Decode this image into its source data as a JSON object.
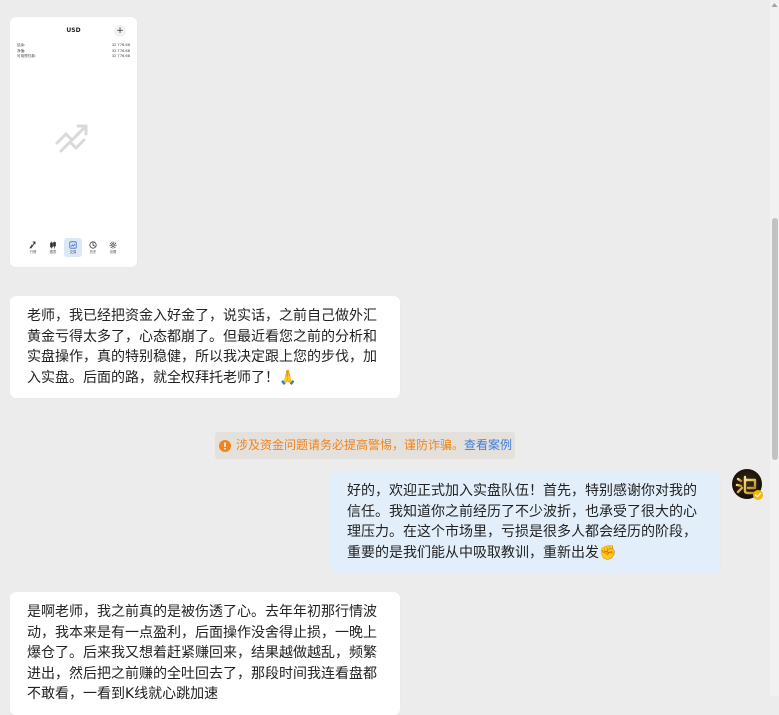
{
  "colors": {
    "background": "#ececec",
    "bubble_left": "#ffffff",
    "bubble_right": "#e2effa",
    "text": "#222222",
    "warning": "#f0841c",
    "link": "#3f7fd6"
  },
  "image_message": {
    "currency": "USD",
    "add_button": "+",
    "rows": [
      {
        "label": "结余:",
        "value": "32 776.68"
      },
      {
        "label": "净值:",
        "value": "32 776.68"
      },
      {
        "label": "可用预付款:",
        "value": "32 776.68"
      }
    ],
    "center_icon": "trend-up-icon",
    "nav": [
      {
        "label": "行情",
        "icon": "quotes-icon"
      },
      {
        "label": "图表",
        "icon": "chart-icon"
      },
      {
        "label": "交易",
        "icon": "trade-icon",
        "active": true
      },
      {
        "label": "历史",
        "icon": "history-icon"
      },
      {
        "label": "设置",
        "icon": "settings-icon"
      }
    ]
  },
  "messages": [
    {
      "side": "left",
      "lines": [
        "老师，我已经把资金入好金了，说实话，之前自己做外汇",
        "黄金亏得太多了，心态都崩了。但最近看您之前的分析和",
        "实盘操作，真的特别稳健，所以我决定跟上您的步伐，加",
        "入实盘。后面的路，就全权拜托老师了！🙏"
      ]
    },
    {
      "side": "right",
      "lines": [
        "好的，欢迎正式加入实盘队伍！首先，特别感谢你对我的",
        "信任。我知道你之前经历了不少波折，也承受了很大的心",
        "理压力。在这个市场里，亏损是很多人都会经历的阶段，",
        "重要的是我们能从中吸取教训，重新出发✊"
      ]
    },
    {
      "side": "left",
      "lines": [
        "是啊老师，我之前真的是被伤透了心。去年年初那行情波",
        "动，我本来是有一点盈利，后面操作没舍得止损，一晚上",
        "爆仓了。后来我又想着赶紧赚回来，结果越做越乱，频繁",
        "进出，然后把之前赚的全吐回去了，那段时间我连看盘都",
        "不敢看，一看到K线就心跳加速"
      ]
    }
  ],
  "notice": {
    "icon": "warning-icon",
    "text": "涉及资金问题请务必提高警惕，谨防诈骗。",
    "link": "查看案例"
  },
  "avatar": {
    "icon": "avatar-image",
    "badge": "verified-badge-icon"
  }
}
